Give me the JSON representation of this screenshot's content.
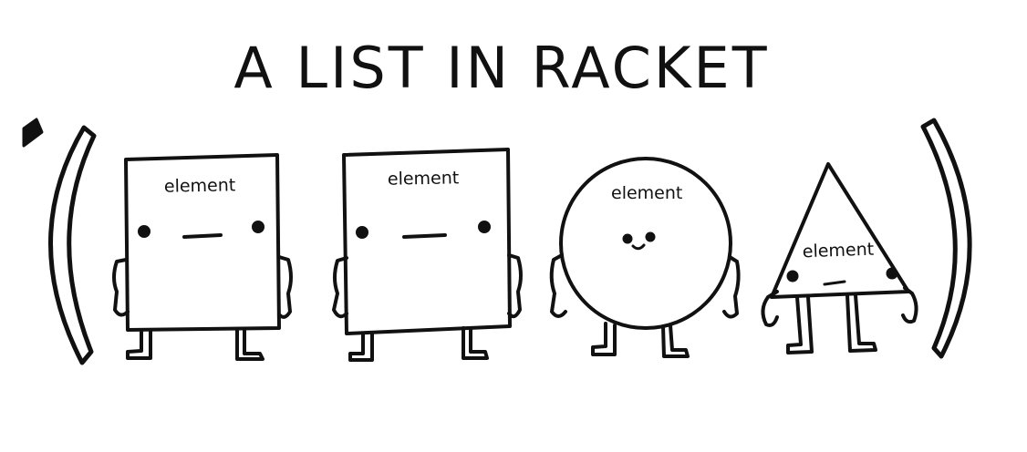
{
  "title": "A LIST IN RACKET",
  "items": [
    {
      "shape": "rectangle",
      "label": "element"
    },
    {
      "shape": "rectangle",
      "label": "element"
    },
    {
      "shape": "circle",
      "label": "element"
    },
    {
      "shape": "triangle",
      "label": "element"
    }
  ],
  "colors": {
    "ink": "#111111",
    "paper": "#ffffff"
  },
  "icons": [
    "quote-mark-icon",
    "open-paren-icon",
    "close-paren-icon"
  ]
}
